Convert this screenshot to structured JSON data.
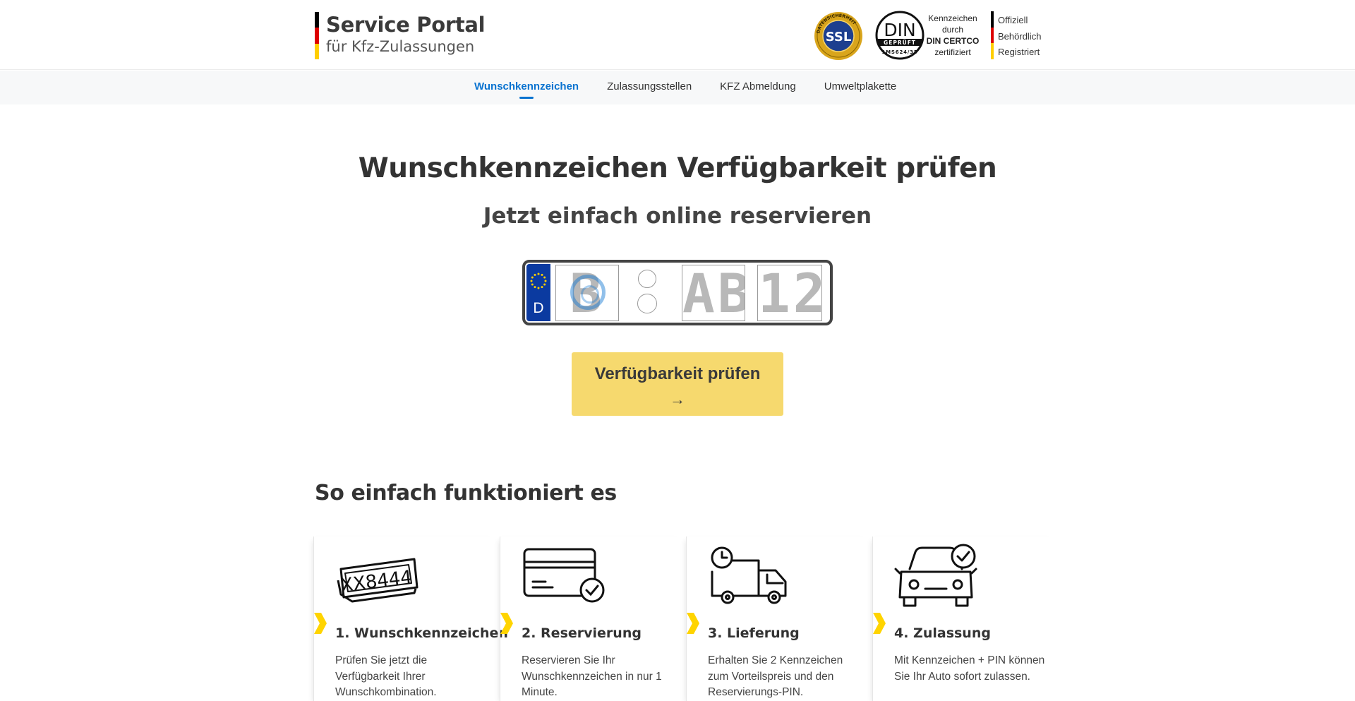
{
  "brand": {
    "title": "Service Portal",
    "subtitle": "für Kfz-Zulassungen",
    "flag_colors": [
      "#000000",
      "#dd0000",
      "#ffce00"
    ]
  },
  "badges": {
    "ssl_label": "SSL",
    "ssl_ring_text": "DATENSICHERHEIT",
    "din_label": "DIN",
    "din_geprueft": "GEPRÜFT",
    "din_number": "1MS624/35",
    "din_line1": "Kennzeichen",
    "din_line2": "durch",
    "din_line3": "DIN CERTCO",
    "din_line4": "zertifiziert"
  },
  "trust": {
    "items": [
      "Offiziell",
      "Behördlich",
      "Registriert"
    ]
  },
  "nav": {
    "items": [
      {
        "label": "Wunschkennzeichen",
        "active": true
      },
      {
        "label": "Zulassungsstellen",
        "active": false
      },
      {
        "label": "KFZ Abmeldung",
        "active": false
      },
      {
        "label": "Umweltplakette",
        "active": false
      }
    ]
  },
  "hero": {
    "title": "Wunschkennzeichen Verfügbarkeit prüfen",
    "subtitle": "Jetzt einfach online reservieren"
  },
  "plate": {
    "country": "D",
    "city_placeholder": "B",
    "letters_placeholder": "AB",
    "numbers_placeholder": "12",
    "eu_color": "#0b3aa0",
    "star_color": "#ffce00"
  },
  "cta": {
    "label": "Verfügbarkeit prüfen",
    "arrow": "→",
    "color": "#f6d96e"
  },
  "steps": {
    "title": "So einfach funktioniert es",
    "items": [
      {
        "icon": "license-plates-icon",
        "title": "1. Wunschkennzeichen",
        "text": "Prüfen Sie jetzt die Verfügbarkeit Ihrer Wunschkombination.",
        "plate_text": "XX8444"
      },
      {
        "icon": "credit-card-check-icon",
        "title": "2. Reservierung",
        "text": "Reservieren Sie Ihr Wunschkennzeichen in nur 1 Minute."
      },
      {
        "icon": "delivery-truck-clock-icon",
        "title": "3. Lieferung",
        "text": "Erhalten Sie 2 Kennzeichen zum Vorteilspreis und den Reservierungs-PIN."
      },
      {
        "icon": "car-check-icon",
        "title": "4. Zulassung",
        "text": "Mit Kennzeichen + PIN können Sie Ihr Auto sofort zulassen."
      }
    ],
    "chevron_color": "#ffd400"
  },
  "accent_color": "#0a73d0"
}
